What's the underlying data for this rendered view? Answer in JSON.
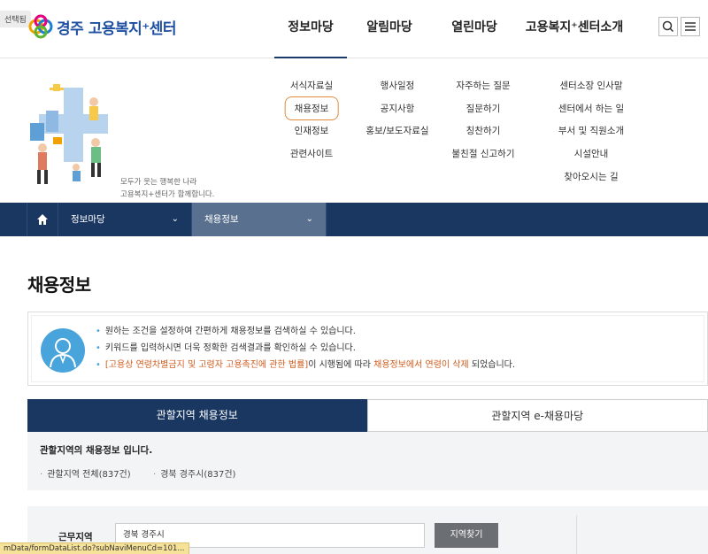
{
  "selected_tag": "선택됨",
  "logo": {
    "text": "경주 고용복지⁺센터"
  },
  "gnb": [
    {
      "label": "정보마당"
    },
    {
      "label": "알림마당"
    },
    {
      "label": "열린마당"
    },
    {
      "label": "고용복지⁺센터소개"
    }
  ],
  "header_buttons": {
    "search_icon": "search-icon",
    "menu_icon": "hamburger-icon"
  },
  "mega": {
    "slogan_line1": "모두가 웃는 행복한 나라",
    "slogan_line2": "고용복지+센터가 함께합니다.",
    "columns": [
      [
        "서식자료실",
        "채용정보",
        "인재정보",
        "관련사이트"
      ],
      [
        "행사일정",
        "공지사항",
        "홍보/보도자료실"
      ],
      [
        "자주하는 질문",
        "질문하기",
        "칭찬하기",
        "불친절 신고하기"
      ],
      [
        "센터소장 인사말",
        "센터에서 하는 일",
        "부서 및 직원소개",
        "시설안내",
        "찾아오시는 길"
      ]
    ],
    "highlight_color": "#e28a3b"
  },
  "location": {
    "home_icon": "home-icon",
    "seg1": "정보마당",
    "seg2": "채용정보",
    "chevron": "⌄"
  },
  "page_title": "채용정보",
  "info": {
    "line1": "원하는 조건을 설정하여 간편하게 채용정보를 검색하실 수 있습니다.",
    "line2": "키워드를 입력하시면 더욱 정확한 검색결과를 확인하실 수 있습니다.",
    "line3_a": "[고용상 연령차별금지 및 고령자 고용촉진에 관한 법률]",
    "line3_b": "이 시행됨에 따라 ",
    "line3_c": "채용정보에서 연령이 삭제",
    "line3_d": " 되었습니다."
  },
  "tabs": [
    {
      "label": "관할지역 채용정보"
    },
    {
      "label": "관할지역 e-채용마당"
    }
  ],
  "region": {
    "title": "관할지역의 채용정보 입니다.",
    "item1": "관할지역 전체(837건)",
    "item2": "경북 경주시(837건)"
  },
  "search": {
    "label": "근무지역",
    "value": "경북 경주시",
    "button": "지역찾기"
  },
  "status_url": "mData/formDataList.do?subNaviMenuCd=101...",
  "colors": {
    "navy": "#1a3762",
    "accent_blue": "#4aa4dc",
    "orange_text": "#d15c1d"
  }
}
